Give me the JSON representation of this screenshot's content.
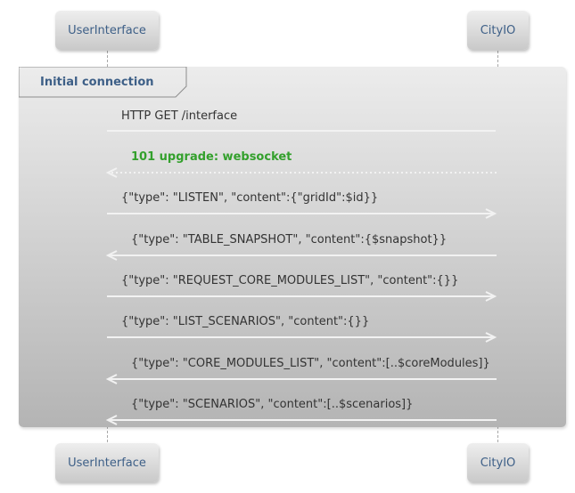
{
  "participants": {
    "left": "UserInterface",
    "right": "CityIO"
  },
  "group": {
    "label": "Initial connection"
  },
  "messages": [
    {
      "text": "HTTP GET /interface",
      "direction": "left-to-right",
      "style": "plain"
    },
    {
      "text": "101 upgrade: websocket",
      "direction": "right-to-left",
      "style": "dashed-reply"
    },
    {
      "text": "{\"type\": \"LISTEN\", \"content\":{\"gridId\":$id}}",
      "direction": "left-to-right",
      "style": "arrow"
    },
    {
      "text": "{\"type\": \"TABLE_SNAPSHOT\", \"content\":{$snapshot}}",
      "direction": "right-to-left",
      "style": "arrow"
    },
    {
      "text": "{\"type\": \"REQUEST_CORE_MODULES_LIST\", \"content\":{}}",
      "direction": "left-to-right",
      "style": "arrow"
    },
    {
      "text": "{\"type\": \"LIST_SCENARIOS\", \"content\":{}}",
      "direction": "left-to-right",
      "style": "arrow"
    },
    {
      "text": "{\"type\": \"CORE_MODULES_LIST\", \"content\":[..$coreModules]}",
      "direction": "right-to-left",
      "style": "arrow"
    },
    {
      "text": "{\"type\": \"SCENARIOS\", \"content\":[..$scenarios]}",
      "direction": "right-to-left",
      "style": "arrow"
    }
  ],
  "colors": {
    "participant_text": "#3d5f87",
    "reply_text": "#33a02c",
    "arrow": "#f2f2f2"
  }
}
